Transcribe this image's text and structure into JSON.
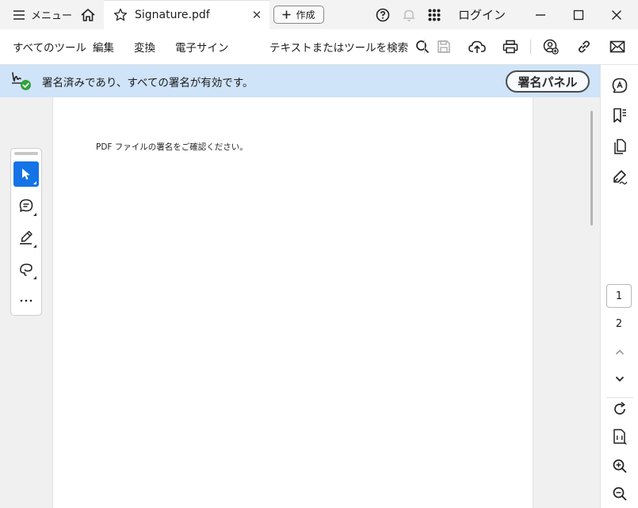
{
  "titlebar": {
    "menu_label": "メニュー",
    "tab_title": "Signature.pdf",
    "tab_close": "✕",
    "create_label": "作成",
    "login_label": "ログイン"
  },
  "menubar": {
    "all_tools": "すべてのツール",
    "edit": "編集",
    "convert": "変換",
    "esign": "電子サイン",
    "search_label": "テキストまたはツールを検索"
  },
  "banner": {
    "message": "署名済みであり、すべての署名が有効です。",
    "panel_button": "署名パネル"
  },
  "document": {
    "body_text": "PDF ファイルの署名をご確認ください。"
  },
  "pagenav": {
    "current_page": "1",
    "next_page": "2"
  },
  "icons": {
    "left_toolbar": [
      "select-pointer-icon",
      "comment-icon",
      "highlight-pen-icon",
      "lasso-draw-icon",
      "more-icon"
    ],
    "right_sidebar": [
      "ai-assistant-icon",
      "bookmarks-icon",
      "pages-icon",
      "fill-sign-icon"
    ]
  },
  "colors": {
    "accent": "#1473e6",
    "banner_bg": "#cfe3f9",
    "success": "#2fa33a"
  }
}
